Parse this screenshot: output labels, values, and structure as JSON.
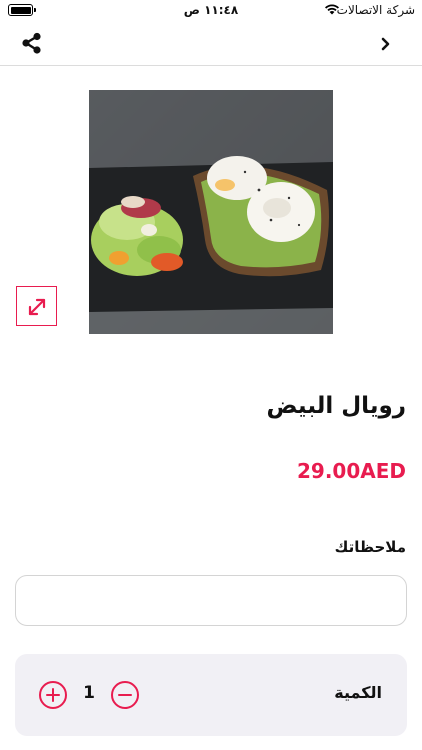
{
  "status_bar": {
    "carrier": "شركة الاتصالات",
    "time": "١١:٤٨ ص",
    "icons": {
      "wifi": "wifi-icon",
      "battery": "battery-icon"
    }
  },
  "nav": {
    "share_icon": "share-icon",
    "back_icon": "chevron-right-icon"
  },
  "product": {
    "image_icon": "food-photo",
    "expand_icon": "expand-arrows-icon",
    "name": "رويال البيض",
    "price": "29.00AED"
  },
  "notes": {
    "label": "ملاحظاتك",
    "value": "",
    "placeholder": ""
  },
  "quantity": {
    "label": "الكمية",
    "value": "1",
    "plus_icon": "plus-circle-icon",
    "minus_icon": "minus-circle-icon"
  },
  "colors": {
    "accent": "#e81c4f",
    "qty_panel_bg": "#f1f0f5"
  }
}
